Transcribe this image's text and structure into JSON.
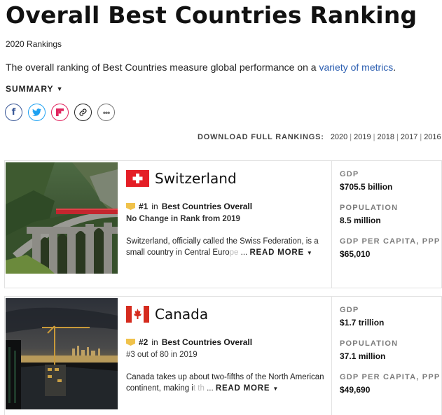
{
  "page": {
    "title": "Overall Best Countries Ranking",
    "subtitle": "2020 Rankings",
    "intro_text": "The overall ranking of Best Countries measure global performance on a ",
    "intro_link": "variety of metrics",
    "intro_end": ".",
    "summary_label": "SUMMARY"
  },
  "share": {
    "icons": [
      "facebook-icon",
      "twitter-icon",
      "flipboard-icon",
      "link-icon",
      "more-icon"
    ]
  },
  "download": {
    "label": "DOWNLOAD FULL RANKINGS:",
    "years": [
      "2020",
      "2019",
      "2018",
      "2017",
      "2016"
    ]
  },
  "countries": [
    {
      "name": "Switzerland",
      "rank": "#1",
      "rank_in": "in",
      "category": "Best Countries Overall",
      "change": "No Change in Rank from 2019",
      "description": "Switzerland, officially called the Swiss Federation, is a small country in Central Euro",
      "description_fade": "pe",
      "readmore": "READ MORE",
      "gdp_label": "GDP",
      "gdp": "$705.5 billion",
      "population_label": "POPULATION",
      "population": "8.5 million",
      "gdp_pc_label": "GDP PER CAPITA, PPP",
      "gdp_pc": "$65,010",
      "flag_color": "#e41e26"
    },
    {
      "name": "Canada",
      "rank": "#2",
      "rank_in": "in",
      "category": "Best Countries Overall",
      "change": "#3 out of 80 in 2019",
      "description": "Canada takes up about two-fifths of the North American continent, making i",
      "description_fade": "t th",
      "readmore": "READ MORE",
      "gdp_label": "GDP",
      "gdp": "$1.7 trillion",
      "population_label": "POPULATION",
      "population": "37.1 million",
      "gdp_pc_label": "GDP PER CAPITA, PPP",
      "gdp_pc": "$49,690",
      "flag_color": "#d52b1e"
    }
  ]
}
